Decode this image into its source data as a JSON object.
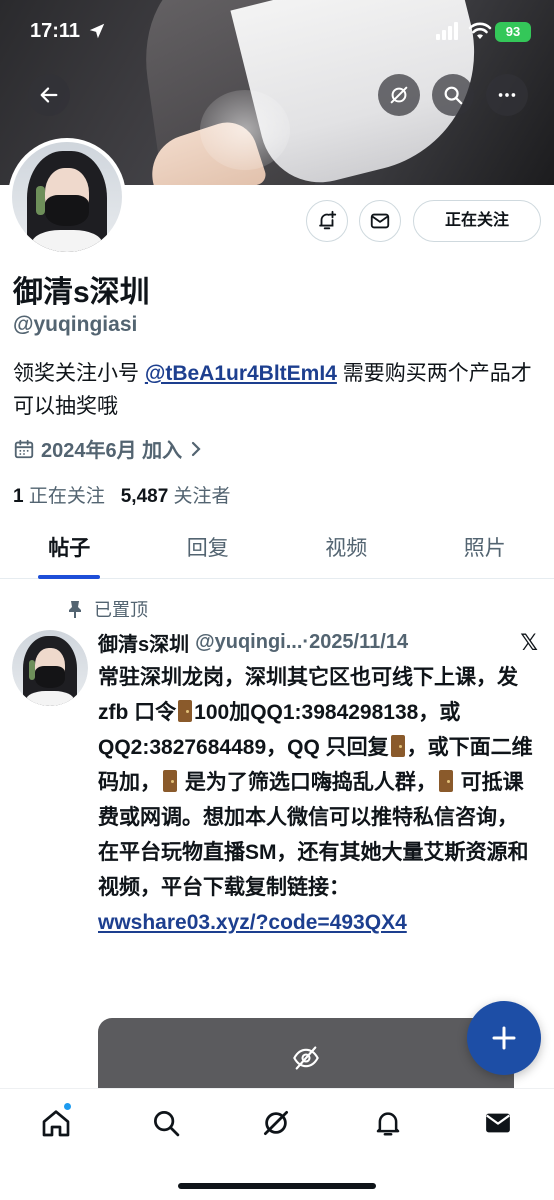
{
  "status_bar": {
    "time": "17:11",
    "battery": "93"
  },
  "profile": {
    "name": "御清s深圳",
    "handle": "@yuqingiasi",
    "bio_text_1": "领奖关注小号 ",
    "bio_mention": "@tBeA1ur4BltEmI4",
    "bio_text_2": " 需要购买两个产品才可以抽奖哦",
    "joined": "2024年6月 加入",
    "following_count": "1",
    "following_label": "正在关注",
    "followers_count": "5,487",
    "followers_label": "关注者",
    "following_button": "正在关注"
  },
  "tabs": [
    "帖子",
    "回复",
    "视频",
    "照片"
  ],
  "post": {
    "pinned_label": "已置顶",
    "author_name": "御清s深圳",
    "author_handle": "@yuqingi...",
    "date": "·2025/11/14",
    "x_logo": "𝕏",
    "body_1": "常驻深圳龙岗，深圳其它区也可线下上课，发zfb 口令",
    "body_2": "100加QQ1:3984298138，或QQ2:3827684489，QQ 只回复",
    "body_3": "，或下面二维码加，",
    "body_4": " 是为了筛选口嗨捣乱人群，",
    "body_5": " 可抵课费或网调。想加本人微信可以推特私信咨询，在平台玩物直播SM，还有其她大量艾斯资源和视频，平台下载复制链接：",
    "link": "wwshare03.xyz/?code=493QX4"
  },
  "icons": {
    "back": "back-arrow-icon",
    "grok": "grok-icon",
    "search": "search-icon",
    "more": "more-icon",
    "notify": "notification-bell-add-icon",
    "message": "mail-icon",
    "calendar": "calendar-icon",
    "pin": "pin-icon",
    "hidden": "eye-off-icon",
    "compose": "plus-icon"
  },
  "colors": {
    "accent": "#1d4ea6",
    "link": "#1d3f8f",
    "battery": "#34c759"
  }
}
